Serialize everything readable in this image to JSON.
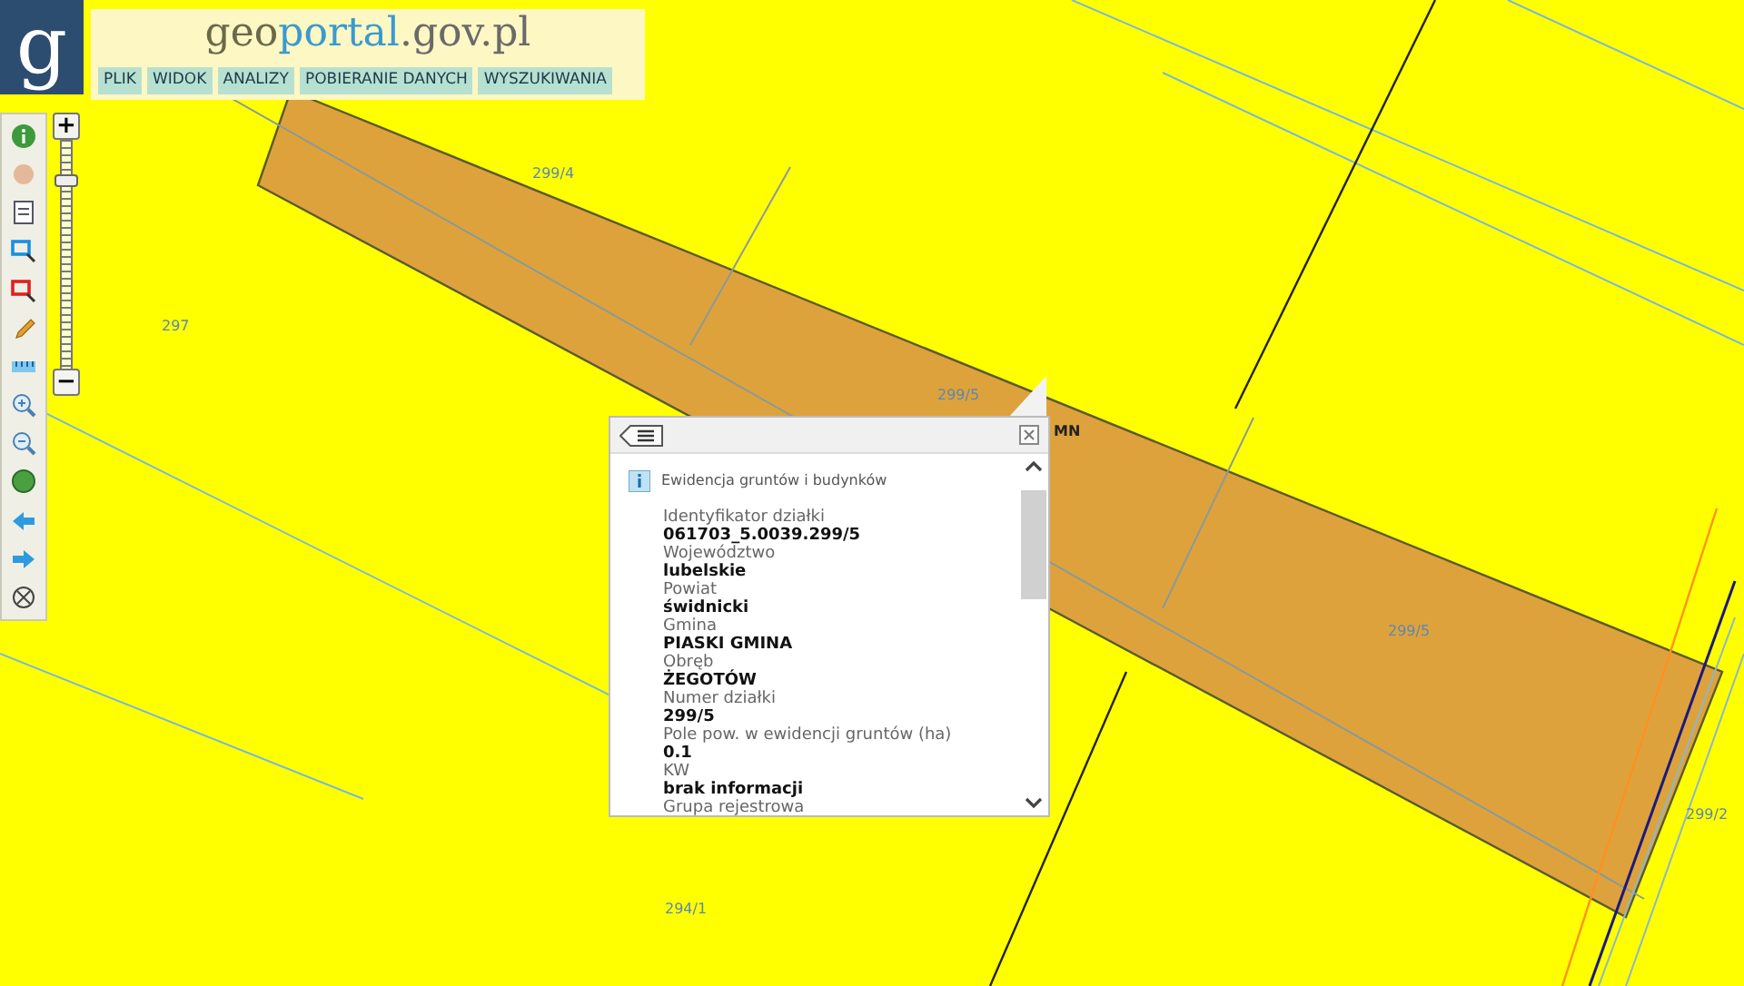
{
  "logo": {
    "letter": "g",
    "parts": [
      "geo",
      "portal",
      ".gov.pl"
    ]
  },
  "menu": [
    {
      "label": "PLIK"
    },
    {
      "label": "WIDOK"
    },
    {
      "label": "ANALIZY"
    },
    {
      "label": "POBIERANIE DANYCH"
    },
    {
      "label": "WYSZUKIWANIA"
    }
  ],
  "zoom": {
    "plus": "+",
    "minus": "−",
    "level": 0.84
  },
  "map_labels": [
    {
      "text": "299/4"
    },
    {
      "text": "297"
    },
    {
      "text": "299/5"
    },
    {
      "text": "299/5"
    },
    {
      "text": "299/2"
    },
    {
      "text": "294/1"
    },
    {
      "text": "MN"
    }
  ],
  "popup": {
    "title": "Ewidencja gruntów i budynków",
    "fields": [
      {
        "label": "Identyfikator działki",
        "value": "061703_5.0039.299/5"
      },
      {
        "label": "Województwo",
        "value": "lubelskie"
      },
      {
        "label": "Powiat",
        "value": "świdnicki"
      },
      {
        "label": "Gmina",
        "value": "PIASKI GMINA"
      },
      {
        "label": "Obręb",
        "value": "ŻEGOTÓW"
      },
      {
        "label": "Numer działki",
        "value": "299/5"
      },
      {
        "label": "Pole pow. w ewidencji gruntów (ha)",
        "value": "0.1"
      },
      {
        "label": "KW",
        "value": "brak informacji"
      },
      {
        "label": "Grupa rejestrowa"
      }
    ]
  }
}
